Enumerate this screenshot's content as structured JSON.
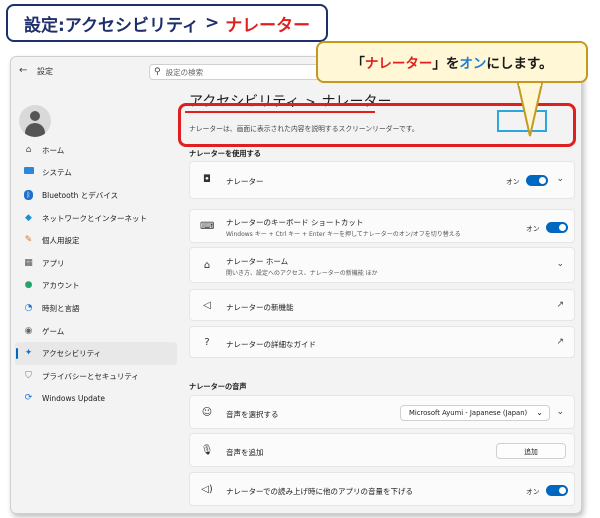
{
  "banner": {
    "part1": "設定:アクセシビリティ",
    "arrow": ">",
    "part2": "ナレーター"
  },
  "titlebar": {
    "title": "設定",
    "search_placeholder": "設定の検索"
  },
  "sidebar": {
    "items": [
      {
        "label": "ホーム",
        "icon": "home-icon"
      },
      {
        "label": "システム",
        "icon": "system-icon"
      },
      {
        "label": "Bluetooth とデバイス",
        "icon": "bluetooth-icon"
      },
      {
        "label": "ネットワークとインターネット",
        "icon": "network-icon"
      },
      {
        "label": "個人用設定",
        "icon": "personalize-icon"
      },
      {
        "label": "アプリ",
        "icon": "apps-icon"
      },
      {
        "label": "アカウント",
        "icon": "account-icon"
      },
      {
        "label": "時刻と言語",
        "icon": "time-language-icon"
      },
      {
        "label": "ゲーム",
        "icon": "game-icon"
      },
      {
        "label": "アクセシビリティ",
        "icon": "accessibility-icon",
        "active": true
      },
      {
        "label": "プライバシーとセキュリティ",
        "icon": "privacy-icon"
      },
      {
        "label": "Windows Update",
        "icon": "update-icon"
      }
    ]
  },
  "main": {
    "crumb1": "アクセシビリティ",
    "crumb_sep": ">",
    "crumb2": "ナレーター",
    "description": "ナレーターは、画面に表示された内容を説明するスクリーンリーダーです。",
    "section1": "ナレーターを使用する",
    "narrator_label": "ナレーター",
    "narrator_state": "オン",
    "shortcut_label": "ナレーターのキーボード ショートカット",
    "shortcut_sub": "Windows キー + Ctrl キー + Enter キーを押してナレーターのオン/オフを切り替える",
    "shortcut_state": "オン",
    "home_label": "ナレーター ホーム",
    "home_sub": "開いき方、設定へのアクセス、ナレーターの新機能 ほか",
    "new_features_label": "ナレーターの新機能",
    "guide_label": "ナレーターの詳細なガイド",
    "section2": "ナレーターの音声",
    "voice_select_label": "音声を選択する",
    "voice_select_value": "Microsoft Ayumi - Japanese (Japan)",
    "voice_add_label": "音声を追加",
    "voice_add_button": "追加",
    "lower_volume_label": "ナレーターでの読み上げ時に他のアプリの音量を下げる",
    "lower_volume_state": "オン"
  },
  "callout": {
    "q_open": "「",
    "name": "ナレーター",
    "q_close": "」",
    "wo": "を",
    "on": "オン",
    "rest": "にします。"
  },
  "colors": {
    "accent": "#0067c0",
    "highlight_red": "#e02020",
    "highlight_blue": "#2aa6e0",
    "callout_bg": "#fff7d6"
  }
}
